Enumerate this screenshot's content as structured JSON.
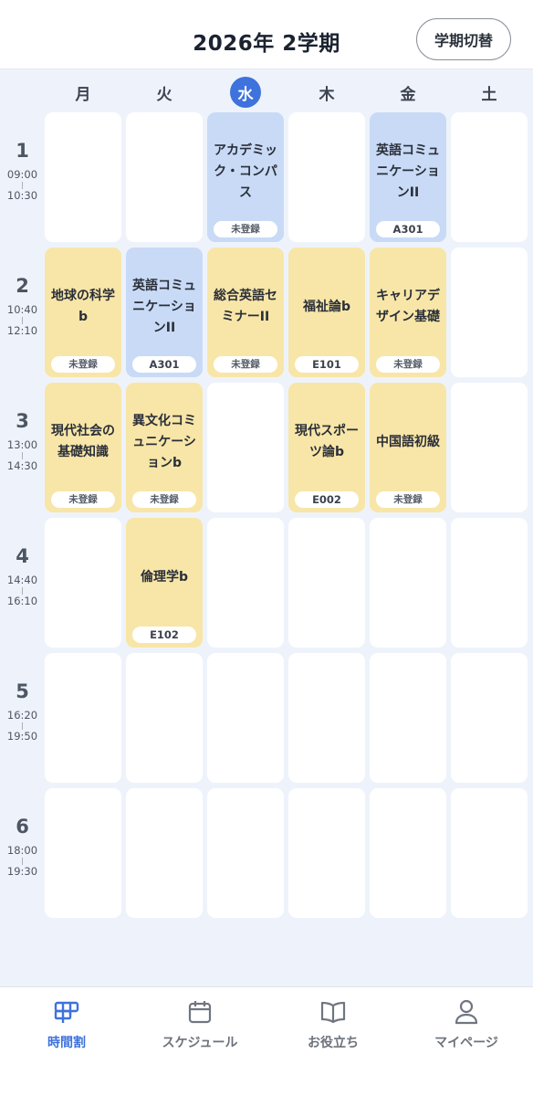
{
  "header": {
    "title": "2026年 2学期",
    "term_switch_label": "学期切替"
  },
  "days": [
    {
      "label": "月",
      "today": false
    },
    {
      "label": "火",
      "today": false
    },
    {
      "label": "水",
      "today": true
    },
    {
      "label": "木",
      "today": false
    },
    {
      "label": "金",
      "today": false
    },
    {
      "label": "土",
      "today": false
    }
  ],
  "periods": [
    {
      "num": "1",
      "start": "09:00",
      "end": "10:30"
    },
    {
      "num": "2",
      "start": "10:40",
      "end": "12:10"
    },
    {
      "num": "3",
      "start": "13:00",
      "end": "14:30"
    },
    {
      "num": "4",
      "start": "14:40",
      "end": "16:10"
    },
    {
      "num": "5",
      "start": "16:20",
      "end": "19:50"
    },
    {
      "num": "6",
      "start": "18:00",
      "end": "19:30"
    }
  ],
  "timetable": [
    [
      null,
      null,
      {
        "name": "アカデミック・コンパス",
        "room": "未登録",
        "color": "blue"
      },
      null,
      {
        "name": "英語コミュニケーションII",
        "room": "A301",
        "color": "blue"
      },
      null
    ],
    [
      {
        "name": "地球の科学b",
        "room": "未登録",
        "color": "yellow"
      },
      {
        "name": "英語コミュニケーションII",
        "room": "A301",
        "color": "blue"
      },
      {
        "name": "総合英語セミナーII",
        "room": "未登録",
        "color": "yellow"
      },
      {
        "name": "福祉論b",
        "room": "E101",
        "color": "yellow"
      },
      {
        "name": "キャリアデザイン基礎",
        "room": "未登録",
        "color": "yellow"
      },
      null
    ],
    [
      {
        "name": "現代社会の基礎知識",
        "room": "未登録",
        "color": "yellow"
      },
      {
        "name": "異文化コミュニケーションb",
        "room": "未登録",
        "color": "yellow"
      },
      null,
      {
        "name": "現代スポーツ論b",
        "room": "E002",
        "color": "yellow"
      },
      {
        "name": "中国語初級",
        "room": "未登録",
        "color": "yellow"
      },
      null
    ],
    [
      null,
      {
        "name": "倫理学b",
        "room": "E102",
        "color": "yellow"
      },
      null,
      null,
      null,
      null
    ],
    [
      null,
      null,
      null,
      null,
      null,
      null
    ],
    [
      null,
      null,
      null,
      null,
      null,
      null
    ]
  ],
  "nav": [
    {
      "label": "時間割",
      "icon": "timetable-icon",
      "active": true
    },
    {
      "label": "スケジュール",
      "icon": "calendar-icon",
      "active": false
    },
    {
      "label": "お役立ち",
      "icon": "book-icon",
      "active": false
    },
    {
      "label": "マイページ",
      "icon": "person-icon",
      "active": false
    }
  ],
  "colors": {
    "accent": "#3e72dc",
    "course_yellow": "#f8e6a8",
    "course_blue": "#c8daf6",
    "background": "#eef3fb"
  }
}
